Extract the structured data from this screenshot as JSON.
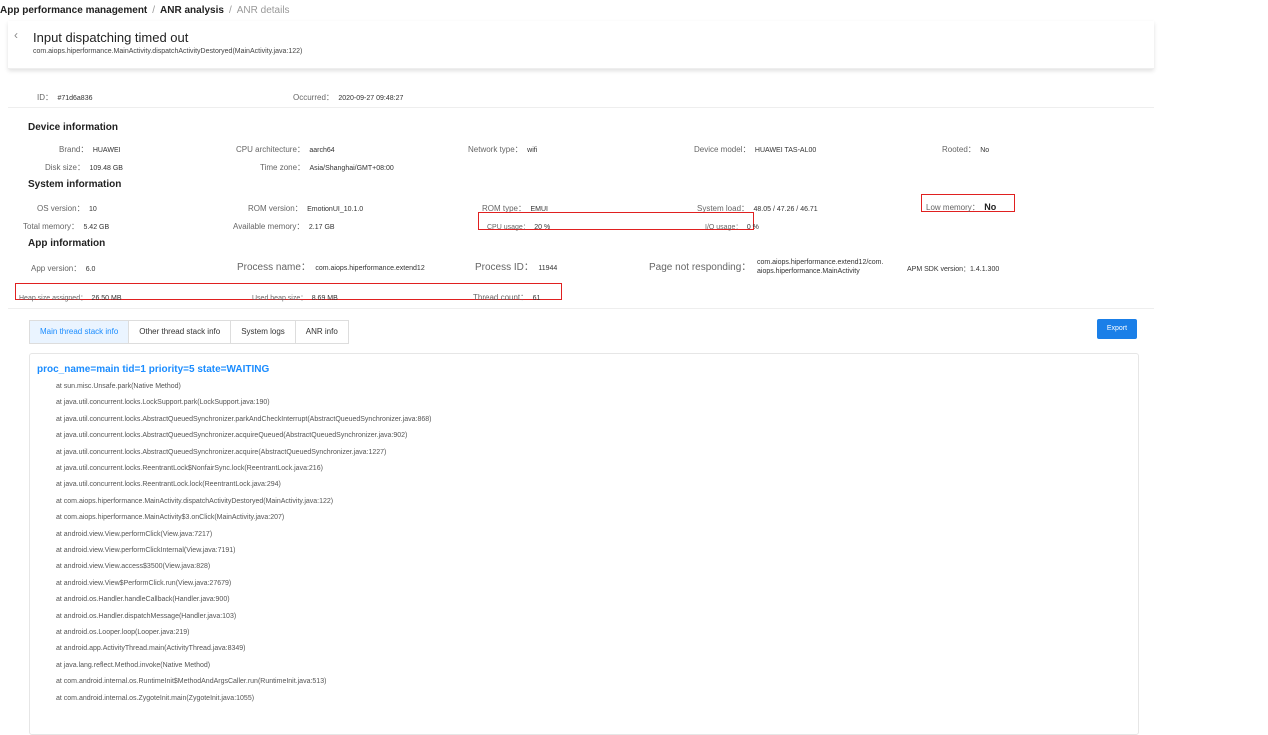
{
  "breadcrumb": {
    "items": [
      "App performance management",
      "ANR analysis",
      "ANR details"
    ],
    "separator": "/"
  },
  "header": {
    "back_glyph": "‹",
    "title": "Input dispatching timed out",
    "subtitle": "com.aiops.hiperformance.MainActivity.dispatchActivityDestoryed(MainActivity.java:122)"
  },
  "summary": {
    "id_label": "ID：",
    "id_value": "#71d6a836",
    "occurred_label": "Occurred：",
    "occurred_value": "2020-09-27 09:48:27"
  },
  "device": {
    "title": "Device information",
    "brand_label": "Brand：",
    "brand_value": "HUAWEI",
    "cpu_arch_label": "CPU architecture：",
    "cpu_arch_value": "aarch64",
    "network_label": "Network type：",
    "network_value": "wifi",
    "model_label": "Device model：",
    "model_value": "HUAWEI TAS-AL00",
    "rooted_label": "Rooted：",
    "rooted_value": "No",
    "disk_label": "Disk size：",
    "disk_value": "109.48 GB",
    "timezone_label": "Time zone：",
    "timezone_value": "Asia/Shanghai/GMT+08:00"
  },
  "system": {
    "title": "System information",
    "os_label": "OS version：",
    "os_value": "10",
    "rom_version_label": "ROM version：",
    "rom_version_value": "EmotionUI_10.1.0",
    "rom_type_label": "ROM type：",
    "rom_type_value": "EMUI",
    "load_label": "System load：",
    "load_value": "48.05 / 47.26 / 46.71",
    "low_memory_label": "Low memory：",
    "low_memory_value": "No",
    "total_mem_label": "Total memory：",
    "total_mem_value": "5.42 GB",
    "avail_mem_label": "Available memory：",
    "avail_mem_value": "2.17 GB",
    "cpu_usage_label": "CPU usage：",
    "cpu_usage_value": "20 %",
    "io_usage_label": "I/O usage：",
    "io_usage_value": "0 %"
  },
  "app": {
    "title": "App information",
    "version_label": "App version：",
    "version_value": "6.0",
    "process_label": "Process name：",
    "process_value": "com.aiops.hiperformance.extend12",
    "pid_label": "Process ID：",
    "pid_value": "11944",
    "page_label": "Page not responding：",
    "page_value_line1": "com.aiops.hiperformance.extend12/com.",
    "page_value_line2": "aiops.hiperformance.MainActivity",
    "sdk_label": "APM SDK version：",
    "sdk_value": "1.4.1.300",
    "heap_assigned_label": "Heap size assigned：",
    "heap_assigned_value": "26.50 MB",
    "heap_used_label": "Used heap size：",
    "heap_used_value": "8.69 MB",
    "threads_label": "Thread count：",
    "threads_value": "61"
  },
  "tabs": [
    "Main thread stack info",
    "Other thread stack info",
    "System logs",
    "ANR info"
  ],
  "export_label": "Export",
  "stack": {
    "header": "proc_name=main tid=1 priority=5 state=WAITING",
    "lines": [
      "at sun.misc.Unsafe.park(Native Method)",
      "at java.util.concurrent.locks.LockSupport.park(LockSupport.java:190)",
      "at java.util.concurrent.locks.AbstractQueuedSynchronizer.parkAndCheckInterrupt(AbstractQueuedSynchronizer.java:868)",
      "at java.util.concurrent.locks.AbstractQueuedSynchronizer.acquireQueued(AbstractQueuedSynchronizer.java:902)",
      "at java.util.concurrent.locks.AbstractQueuedSynchronizer.acquire(AbstractQueuedSynchronizer.java:1227)",
      "at java.util.concurrent.locks.ReentrantLock$NonfairSync.lock(ReentrantLock.java:216)",
      "at java.util.concurrent.locks.ReentrantLock.lock(ReentrantLock.java:294)",
      "at com.aiops.hiperformance.MainActivity.dispatchActivityDestoryed(MainActivity.java:122)",
      "at com.aiops.hiperformance.MainActivity$3.onClick(MainActivity.java:207)",
      "at android.view.View.performClick(View.java:7217)",
      "at android.view.View.performClickInternal(View.java:7191)",
      "at android.view.View.access$3500(View.java:828)",
      "at android.view.View$PerformClick.run(View.java:27679)",
      "at android.os.Handler.handleCallback(Handler.java:900)",
      "at android.os.Handler.dispatchMessage(Handler.java:103)",
      "at android.os.Looper.loop(Looper.java:219)",
      "at android.app.ActivityThread.main(ActivityThread.java:8349)",
      "at java.lang.reflect.Method.invoke(Native Method)",
      "at com.android.internal.os.RuntimeInit$MethodAndArgsCaller.run(RuntimeInit.java:513)",
      "at com.android.internal.os.ZygoteInit.main(ZygoteInit.java:1055)"
    ]
  },
  "colors": {
    "accent": "#1a8cff",
    "highlight_box": "#e02020",
    "export_bg": "#1a7fe8"
  }
}
